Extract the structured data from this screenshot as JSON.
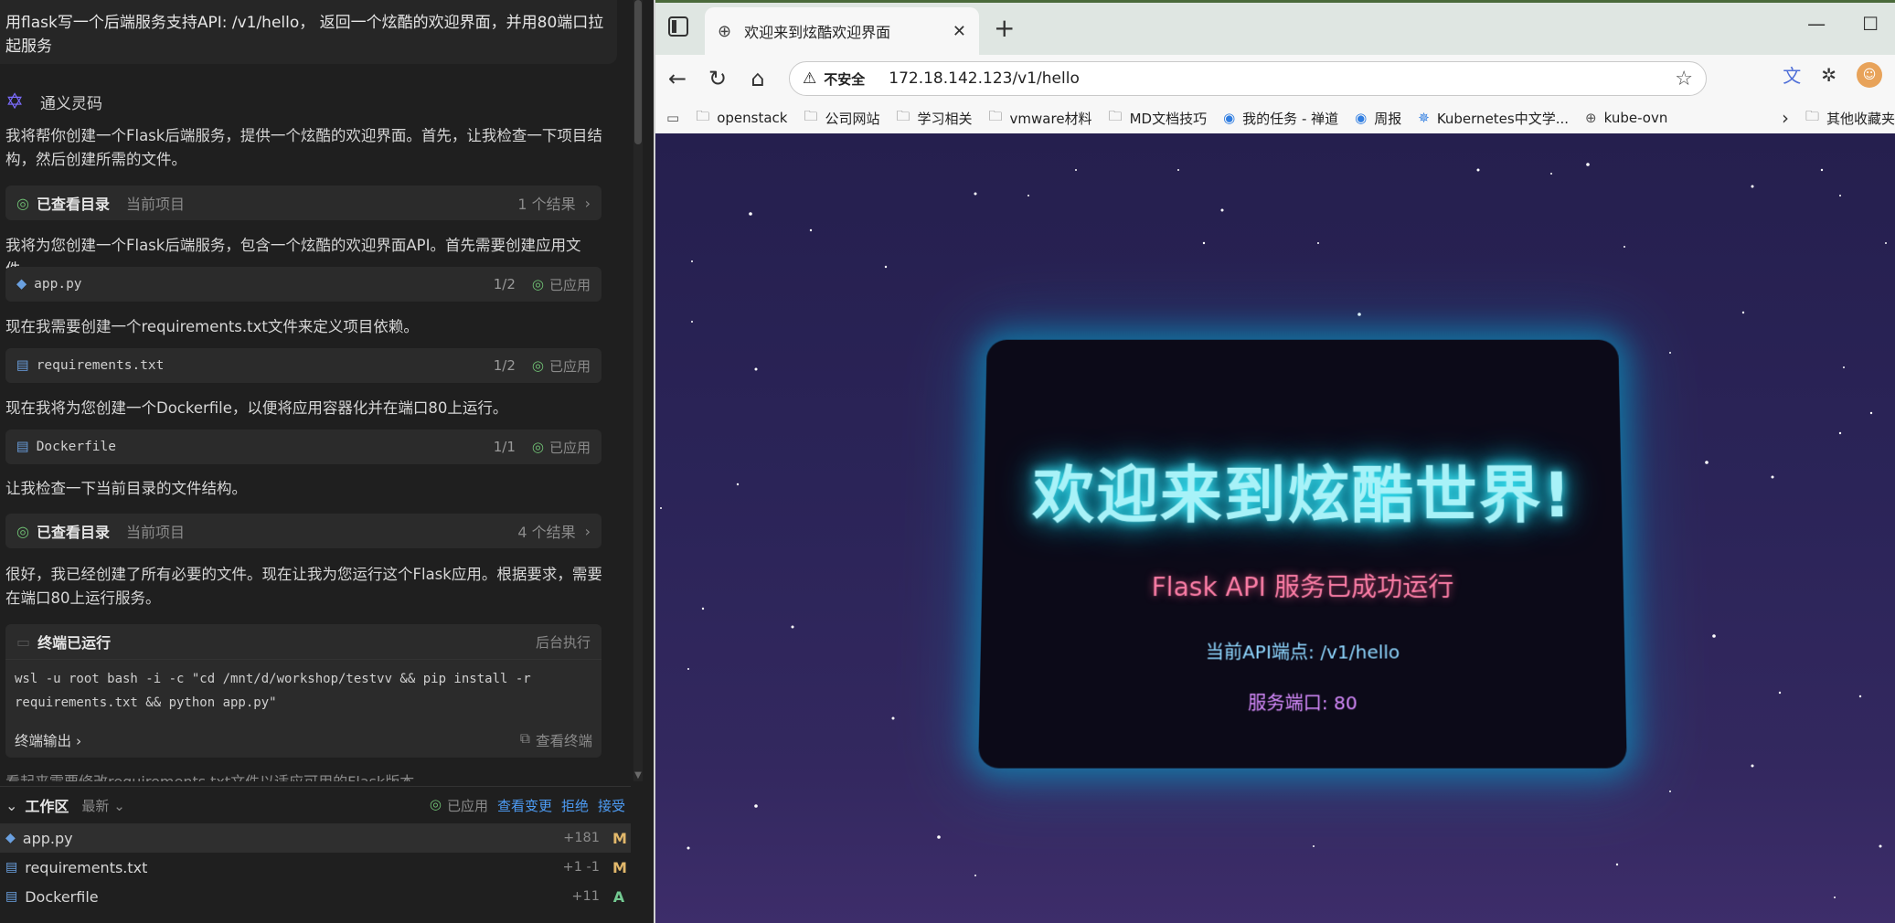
{
  "left": {
    "user_message": "用flask写一个后端服务支持API: /v1/hello， 返回一个炫酷的欢迎界面，并用80端口拉起服务",
    "assistant_name": "通义灵码",
    "messages": [
      "我将帮你创建一个Flask后端服务，提供一个炫酷的欢迎界面。首先，让我检查一下项目结构，然后创建所需的文件。",
      "我将为您创建一个Flask后端服务，包含一个炫酷的欢迎界面API。首先需要创建应用文件。",
      "现在我需要创建一个requirements.txt文件来定义项目依赖。",
      "现在我将为您创建一个Dockerfile，以便将应用容器化并在端口80上运行。",
      "让我检查一下当前目录的文件结构。",
      "很好，我已经创建了所有必要的文件。现在让我为您运行这个Flask应用。根据要求，需要在端口80上运行服务。",
      "看起来需要修改requirements.txt文件以适应可用的Flask版本"
    ],
    "dir_card_1": {
      "label": "已查看目录",
      "sub": "当前项目",
      "result": "1 个结果"
    },
    "dir_card_2": {
      "label": "已查看目录",
      "sub": "当前项目",
      "result": "4 个结果"
    },
    "files": [
      {
        "name": "app.py",
        "count": "1/2",
        "status": "已应用"
      },
      {
        "name": "requirements.txt",
        "count": "1/2",
        "status": "已应用"
      },
      {
        "name": "Dockerfile",
        "count": "1/1",
        "status": "已应用"
      }
    ],
    "terminal": {
      "label": "终端已运行",
      "mode": "后台执行",
      "cmd_line1": "wsl -u root bash -i -c \"cd /mnt/d/workshop/testvv && pip install -r",
      "cmd_line2": "requirements.txt && python app.py\"",
      "output": "终端输出",
      "view": "查看终端"
    },
    "workspace": {
      "title": "工作区",
      "newest": "最新",
      "applied": "已应用",
      "view_changes": "查看变更",
      "reject": "拒绝",
      "accept": "接受",
      "rows": [
        {
          "name": "app.py",
          "diff": "+181",
          "status": "M"
        },
        {
          "name": "requirements.txt",
          "diff": "+1 -1",
          "status": "M"
        },
        {
          "name": "Dockerfile",
          "diff": "+11",
          "status": "A"
        }
      ]
    }
  },
  "browser": {
    "tab_title": "欢迎来到炫酷欢迎界面",
    "insecure_label": "不安全",
    "url": "172.18.142.123/v1/hello",
    "bookmarks": [
      "openstack",
      "公司网站",
      "学习相关",
      "vmware材料",
      "MD文档技巧",
      "我的任务 - 禅道",
      "周报",
      "Kubernetes中文学...",
      "kube-ovn",
      "其他收藏夹"
    ],
    "page": {
      "hero": "欢迎来到炫酷世界!",
      "subtitle": "Flask API 服务已成功运行",
      "endpoint": "当前API端点: /v1/hello",
      "port": "服务端口: 80"
    }
  }
}
